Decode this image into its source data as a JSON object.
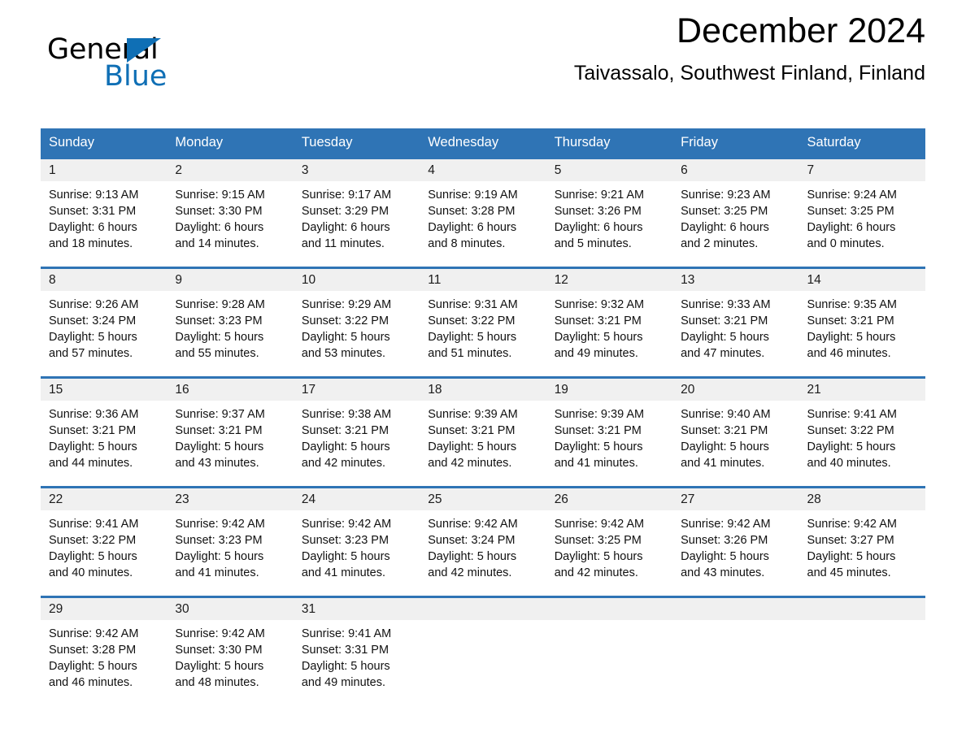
{
  "brand": {
    "name_top": "General",
    "name_bottom": "Blue",
    "accent_color": "#0f6fb5"
  },
  "header": {
    "title": "December 2024",
    "subtitle": "Taivassalo, Southwest Finland, Finland"
  },
  "theme": {
    "header_bar_color": "#2f74b5",
    "day_band_color": "#f0f0f0",
    "row_rule_color": "#2f74b5",
    "text_color": "#000000"
  },
  "weekday_headers": [
    "Sunday",
    "Monday",
    "Tuesday",
    "Wednesday",
    "Thursday",
    "Friday",
    "Saturday"
  ],
  "weeks": [
    [
      {
        "day": "1",
        "details": "Sunrise: 9:13 AM\nSunset: 3:31 PM\nDaylight: 6 hours\nand 18 minutes."
      },
      {
        "day": "2",
        "details": "Sunrise: 9:15 AM\nSunset: 3:30 PM\nDaylight: 6 hours\nand 14 minutes."
      },
      {
        "day": "3",
        "details": "Sunrise: 9:17 AM\nSunset: 3:29 PM\nDaylight: 6 hours\nand 11 minutes."
      },
      {
        "day": "4",
        "details": "Sunrise: 9:19 AM\nSunset: 3:28 PM\nDaylight: 6 hours\nand 8 minutes."
      },
      {
        "day": "5",
        "details": "Sunrise: 9:21 AM\nSunset: 3:26 PM\nDaylight: 6 hours\nand 5 minutes."
      },
      {
        "day": "6",
        "details": "Sunrise: 9:23 AM\nSunset: 3:25 PM\nDaylight: 6 hours\nand 2 minutes."
      },
      {
        "day": "7",
        "details": "Sunrise: 9:24 AM\nSunset: 3:25 PM\nDaylight: 6 hours\nand 0 minutes."
      }
    ],
    [
      {
        "day": "8",
        "details": "Sunrise: 9:26 AM\nSunset: 3:24 PM\nDaylight: 5 hours\nand 57 minutes."
      },
      {
        "day": "9",
        "details": "Sunrise: 9:28 AM\nSunset: 3:23 PM\nDaylight: 5 hours\nand 55 minutes."
      },
      {
        "day": "10",
        "details": "Sunrise: 9:29 AM\nSunset: 3:22 PM\nDaylight: 5 hours\nand 53 minutes."
      },
      {
        "day": "11",
        "details": "Sunrise: 9:31 AM\nSunset: 3:22 PM\nDaylight: 5 hours\nand 51 minutes."
      },
      {
        "day": "12",
        "details": "Sunrise: 9:32 AM\nSunset: 3:21 PM\nDaylight: 5 hours\nand 49 minutes."
      },
      {
        "day": "13",
        "details": "Sunrise: 9:33 AM\nSunset: 3:21 PM\nDaylight: 5 hours\nand 47 minutes."
      },
      {
        "day": "14",
        "details": "Sunrise: 9:35 AM\nSunset: 3:21 PM\nDaylight: 5 hours\nand 46 minutes."
      }
    ],
    [
      {
        "day": "15",
        "details": "Sunrise: 9:36 AM\nSunset: 3:21 PM\nDaylight: 5 hours\nand 44 minutes."
      },
      {
        "day": "16",
        "details": "Sunrise: 9:37 AM\nSunset: 3:21 PM\nDaylight: 5 hours\nand 43 minutes."
      },
      {
        "day": "17",
        "details": "Sunrise: 9:38 AM\nSunset: 3:21 PM\nDaylight: 5 hours\nand 42 minutes."
      },
      {
        "day": "18",
        "details": "Sunrise: 9:39 AM\nSunset: 3:21 PM\nDaylight: 5 hours\nand 42 minutes."
      },
      {
        "day": "19",
        "details": "Sunrise: 9:39 AM\nSunset: 3:21 PM\nDaylight: 5 hours\nand 41 minutes."
      },
      {
        "day": "20",
        "details": "Sunrise: 9:40 AM\nSunset: 3:21 PM\nDaylight: 5 hours\nand 41 minutes."
      },
      {
        "day": "21",
        "details": "Sunrise: 9:41 AM\nSunset: 3:22 PM\nDaylight: 5 hours\nand 40 minutes."
      }
    ],
    [
      {
        "day": "22",
        "details": "Sunrise: 9:41 AM\nSunset: 3:22 PM\nDaylight: 5 hours\nand 40 minutes."
      },
      {
        "day": "23",
        "details": "Sunrise: 9:42 AM\nSunset: 3:23 PM\nDaylight: 5 hours\nand 41 minutes."
      },
      {
        "day": "24",
        "details": "Sunrise: 9:42 AM\nSunset: 3:23 PM\nDaylight: 5 hours\nand 41 minutes."
      },
      {
        "day": "25",
        "details": "Sunrise: 9:42 AM\nSunset: 3:24 PM\nDaylight: 5 hours\nand 42 minutes."
      },
      {
        "day": "26",
        "details": "Sunrise: 9:42 AM\nSunset: 3:25 PM\nDaylight: 5 hours\nand 42 minutes."
      },
      {
        "day": "27",
        "details": "Sunrise: 9:42 AM\nSunset: 3:26 PM\nDaylight: 5 hours\nand 43 minutes."
      },
      {
        "day": "28",
        "details": "Sunrise: 9:42 AM\nSunset: 3:27 PM\nDaylight: 5 hours\nand 45 minutes."
      }
    ],
    [
      {
        "day": "29",
        "details": "Sunrise: 9:42 AM\nSunset: 3:28 PM\nDaylight: 5 hours\nand 46 minutes."
      },
      {
        "day": "30",
        "details": "Sunrise: 9:42 AM\nSunset: 3:30 PM\nDaylight: 5 hours\nand 48 minutes."
      },
      {
        "day": "31",
        "details": "Sunrise: 9:41 AM\nSunset: 3:31 PM\nDaylight: 5 hours\nand 49 minutes."
      },
      {
        "day": "",
        "details": ""
      },
      {
        "day": "",
        "details": ""
      },
      {
        "day": "",
        "details": ""
      },
      {
        "day": "",
        "details": ""
      }
    ]
  ]
}
